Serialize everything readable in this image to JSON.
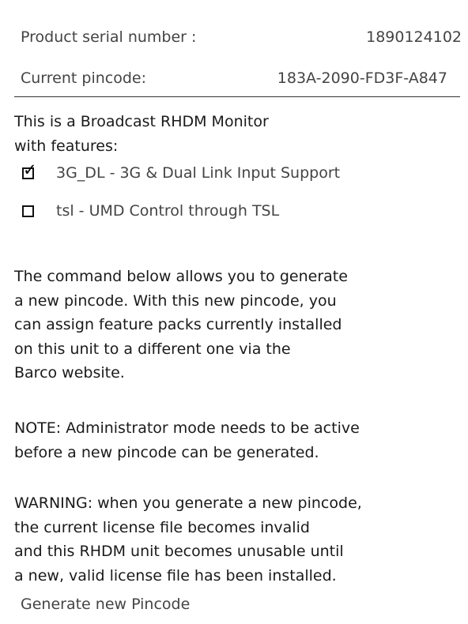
{
  "info": {
    "serial_label": "Product serial number :",
    "serial_value": "1890124102",
    "pincode_label": "Current pincode:",
    "pincode_value": "183A-2090-FD3F-A847"
  },
  "intro": "This is a Broadcast RHDM Monitor\nwith features:",
  "features": [
    {
      "label": "3G_DL - 3G & Dual Link Input Support",
      "checked": true
    },
    {
      "label": "tsl - UMD Control through TSL",
      "checked": false
    }
  ],
  "paragraphs": {
    "command": "The command below allows you to generate\na new pincode. With this new pincode, you\ncan assign feature packs currently installed\non this unit to a different one via the\nBarco website.",
    "note": "NOTE: Administrator mode needs to be active\nbefore a new pincode can be generated.",
    "warning": "WARNING: when you generate a new pincode,\nthe current license file becomes invalid\nand this RHDM unit becomes unusable until\na new, valid license file has been installed."
  },
  "actions": {
    "generate_label": "Generate new Pincode"
  }
}
